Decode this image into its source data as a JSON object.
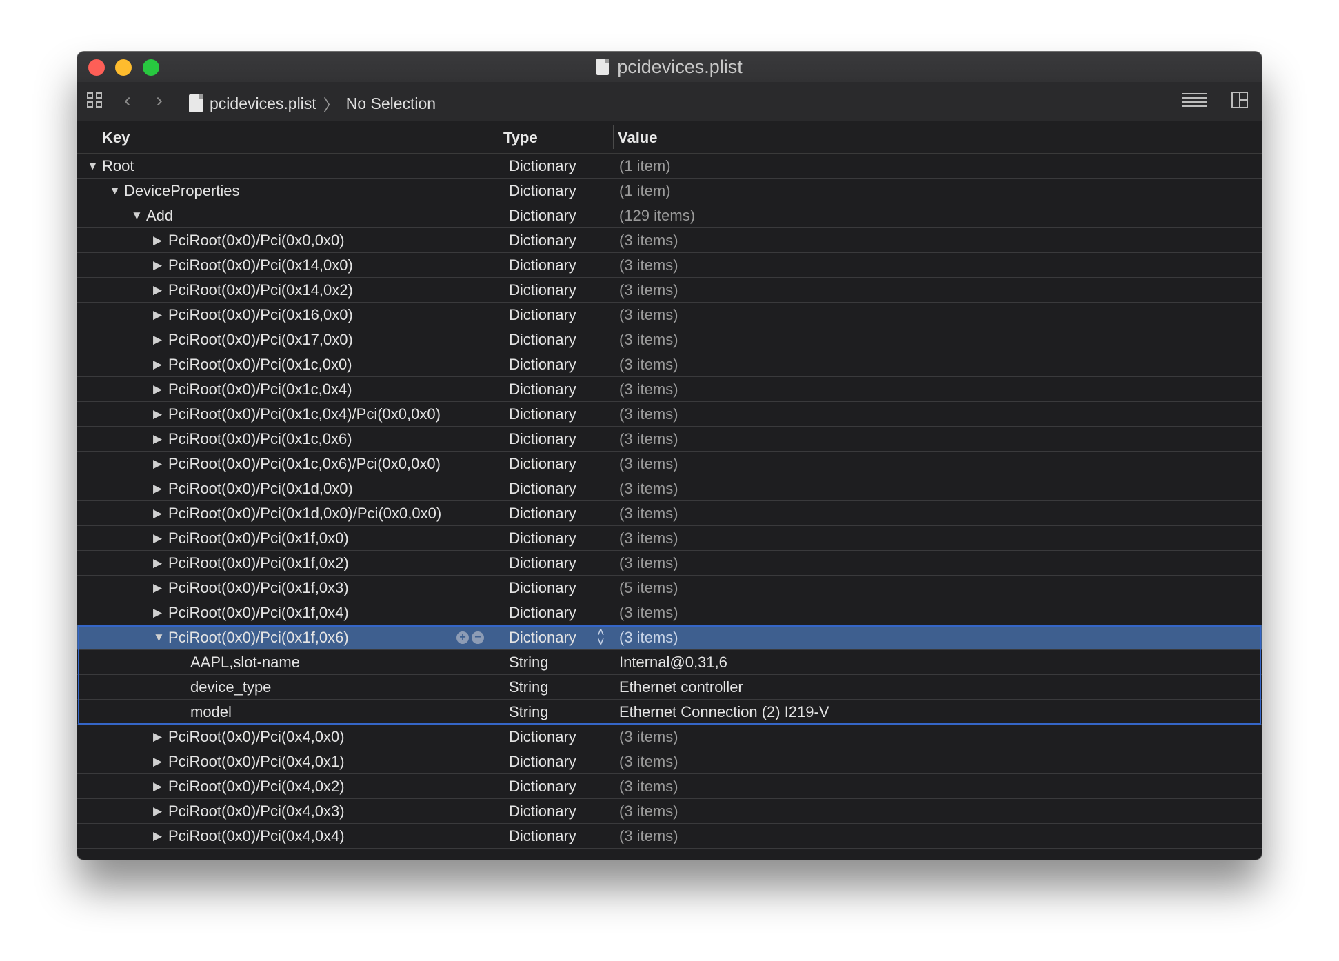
{
  "window": {
    "title": "pcidevices.plist"
  },
  "toolbar": {
    "file_name": "pcidevices.plist",
    "selection": "No Selection"
  },
  "header": {
    "key": "Key",
    "type": "Type",
    "value": "Value"
  },
  "rows": [
    {
      "key": "Root",
      "type": "Dictionary",
      "value": "(1 item)",
      "depth": 0,
      "expanded": true
    },
    {
      "key": "DeviceProperties",
      "type": "Dictionary",
      "value": "(1 item)",
      "depth": 1,
      "expanded": true
    },
    {
      "key": "Add",
      "type": "Dictionary",
      "value": "(129 items)",
      "depth": 2,
      "expanded": true
    },
    {
      "key": "PciRoot(0x0)/Pci(0x0,0x0)",
      "type": "Dictionary",
      "value": "(3 items)",
      "depth": 3,
      "expanded": false
    },
    {
      "key": "PciRoot(0x0)/Pci(0x14,0x0)",
      "type": "Dictionary",
      "value": "(3 items)",
      "depth": 3,
      "expanded": false
    },
    {
      "key": "PciRoot(0x0)/Pci(0x14,0x2)",
      "type": "Dictionary",
      "value": "(3 items)",
      "depth": 3,
      "expanded": false
    },
    {
      "key": "PciRoot(0x0)/Pci(0x16,0x0)",
      "type": "Dictionary",
      "value": "(3 items)",
      "depth": 3,
      "expanded": false
    },
    {
      "key": "PciRoot(0x0)/Pci(0x17,0x0)",
      "type": "Dictionary",
      "value": "(3 items)",
      "depth": 3,
      "expanded": false
    },
    {
      "key": "PciRoot(0x0)/Pci(0x1c,0x0)",
      "type": "Dictionary",
      "value": "(3 items)",
      "depth": 3,
      "expanded": false
    },
    {
      "key": "PciRoot(0x0)/Pci(0x1c,0x4)",
      "type": "Dictionary",
      "value": "(3 items)",
      "depth": 3,
      "expanded": false
    },
    {
      "key": "PciRoot(0x0)/Pci(0x1c,0x4)/Pci(0x0,0x0)",
      "type": "Dictionary",
      "value": "(3 items)",
      "depth": 3,
      "expanded": false
    },
    {
      "key": "PciRoot(0x0)/Pci(0x1c,0x6)",
      "type": "Dictionary",
      "value": "(3 items)",
      "depth": 3,
      "expanded": false
    },
    {
      "key": "PciRoot(0x0)/Pci(0x1c,0x6)/Pci(0x0,0x0)",
      "type": "Dictionary",
      "value": "(3 items)",
      "depth": 3,
      "expanded": false
    },
    {
      "key": "PciRoot(0x0)/Pci(0x1d,0x0)",
      "type": "Dictionary",
      "value": "(3 items)",
      "depth": 3,
      "expanded": false
    },
    {
      "key": "PciRoot(0x0)/Pci(0x1d,0x0)/Pci(0x0,0x0)",
      "type": "Dictionary",
      "value": "(3 items)",
      "depth": 3,
      "expanded": false
    },
    {
      "key": "PciRoot(0x0)/Pci(0x1f,0x0)",
      "type": "Dictionary",
      "value": "(3 items)",
      "depth": 3,
      "expanded": false
    },
    {
      "key": "PciRoot(0x0)/Pci(0x1f,0x2)",
      "type": "Dictionary",
      "value": "(3 items)",
      "depth": 3,
      "expanded": false
    },
    {
      "key": "PciRoot(0x0)/Pci(0x1f,0x3)",
      "type": "Dictionary",
      "value": "(5 items)",
      "depth": 3,
      "expanded": false
    },
    {
      "key": "PciRoot(0x0)/Pci(0x1f,0x4)",
      "type": "Dictionary",
      "value": "(3 items)",
      "depth": 3,
      "expanded": false
    },
    {
      "key": "PciRoot(0x0)/Pci(0x1f,0x6)",
      "type": "Dictionary",
      "value": "(3 items)",
      "depth": 3,
      "expanded": true,
      "selected": true
    },
    {
      "key": "AAPL,slot-name",
      "type": "String",
      "value": "Internal@0,31,6",
      "depth": 4,
      "leaf": true,
      "child": true
    },
    {
      "key": "device_type",
      "type": "String",
      "value": "Ethernet controller",
      "depth": 4,
      "leaf": true,
      "child": true
    },
    {
      "key": "model",
      "type": "String",
      "value": "Ethernet Connection (2) I219-V",
      "depth": 4,
      "leaf": true,
      "child": true
    },
    {
      "key": "PciRoot(0x0)/Pci(0x4,0x0)",
      "type": "Dictionary",
      "value": "(3 items)",
      "depth": 3,
      "expanded": false
    },
    {
      "key": "PciRoot(0x0)/Pci(0x4,0x1)",
      "type": "Dictionary",
      "value": "(3 items)",
      "depth": 3,
      "expanded": false
    },
    {
      "key": "PciRoot(0x0)/Pci(0x4,0x2)",
      "type": "Dictionary",
      "value": "(3 items)",
      "depth": 3,
      "expanded": false
    },
    {
      "key": "PciRoot(0x0)/Pci(0x4,0x3)",
      "type": "Dictionary",
      "value": "(3 items)",
      "depth": 3,
      "expanded": false
    },
    {
      "key": "PciRoot(0x0)/Pci(0x4,0x4)",
      "type": "Dictionary",
      "value": "(3 items)",
      "depth": 3,
      "expanded": false
    }
  ]
}
